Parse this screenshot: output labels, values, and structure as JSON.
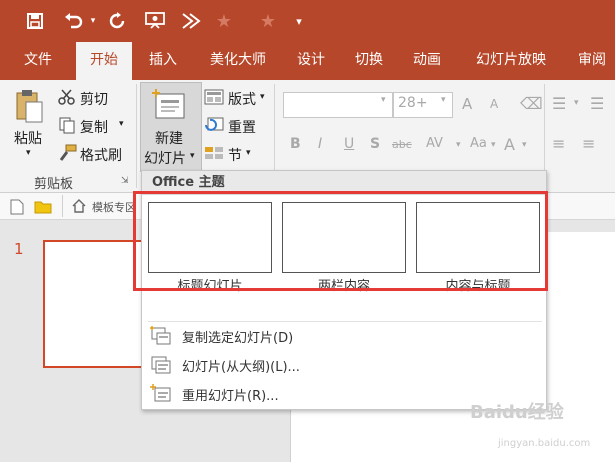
{
  "qat": {
    "save_icon": "save-icon",
    "undo_icon": "undo-icon",
    "redo_icon": "repeat-icon",
    "present_icon": "present-icon",
    "animate_icon": "animate-icon"
  },
  "tabs": [
    {
      "label": "文件"
    },
    {
      "label": "开始"
    },
    {
      "label": "插入"
    },
    {
      "label": "美化大师"
    },
    {
      "label": "设计"
    },
    {
      "label": "切换"
    },
    {
      "label": "动画"
    },
    {
      "label": "幻灯片放映"
    },
    {
      "label": "审阅"
    }
  ],
  "ribbon": {
    "paste_label": "粘贴",
    "cut_label": "剪切",
    "copy_label": "复制",
    "format_painter_label": "格式刷",
    "clipboard_group": "剪贴板",
    "new_slide_line1": "新建",
    "new_slide_line2": "幻灯片",
    "layout_label": "版式",
    "reset_label": "重置",
    "section_label": "节",
    "font_size": "28+",
    "bold": "B",
    "italic": "I",
    "underline": "U",
    "shadow": "S",
    "strikethrough": "abc",
    "font_color": "A"
  },
  "subbar": {
    "tab_label": "模板专区"
  },
  "slides": {
    "number": "1"
  },
  "dropdown": {
    "header": "Office 主题",
    "layouts": [
      {
        "label": "标题幻灯片"
      },
      {
        "label": "两栏内容"
      },
      {
        "label": "内容与标题"
      }
    ],
    "items": [
      {
        "label": "复制选定幻灯片(D)"
      },
      {
        "label": "幻灯片(从大纲)(L)..."
      },
      {
        "label": "重用幻灯片(R)..."
      }
    ]
  },
  "watermark": {
    "text": "Baidu经验",
    "url_text": "jingyan.baidu.com"
  },
  "colors": {
    "brand": "#b7472a",
    "highlight": "#e53935",
    "accent": "#d24726"
  }
}
